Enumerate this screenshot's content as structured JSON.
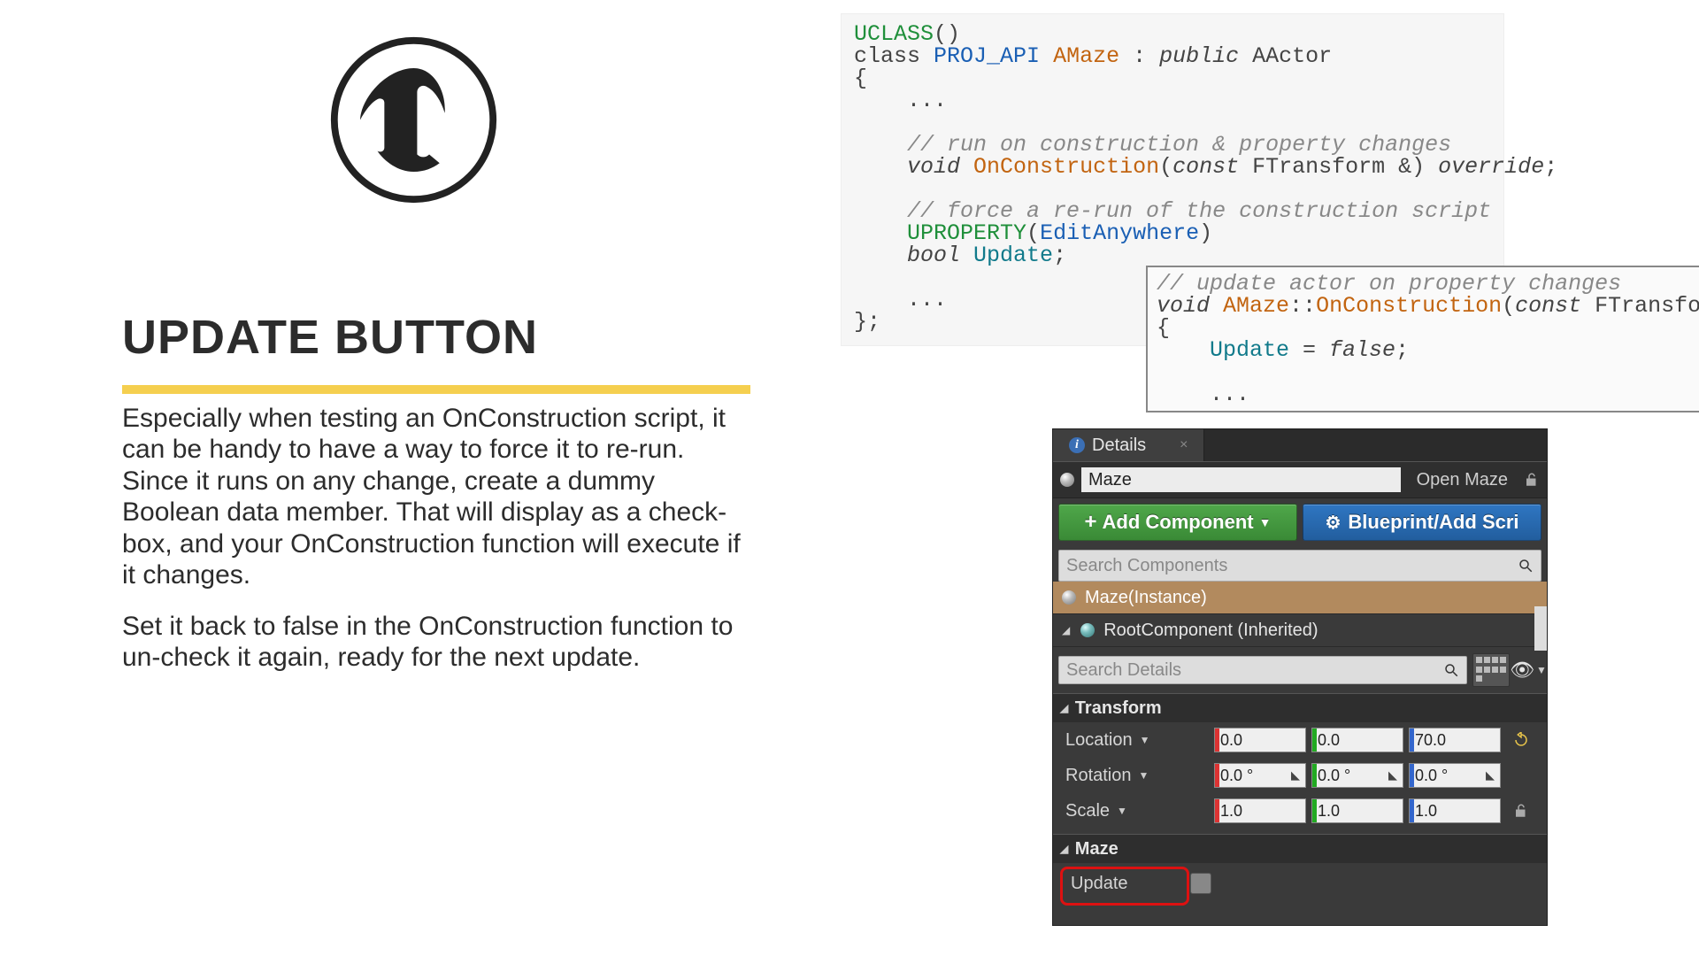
{
  "title": "UPDATE BUTTON",
  "body1": "Especially when testing an OnConstruction script, it can be handy to have a way to force it to re-run. Since it runs on any change, create a dummy Boolean data member. That will display as a check-box, and your OnConstruction function will execute if it changes.",
  "body2": "Set it back to false in the OnConstruction function to un-check it again, ready for the next update.",
  "code1": {
    "l1a": "UCLASS",
    "l1b": "()",
    "l2a": "class ",
    "l2b": "PROJ_API",
    "l2c": " ",
    "l2d": "AMaze",
    "l2e": " : ",
    "l2f": "public",
    "l2g": " AActor",
    "l3": "{",
    "l4": "    ...",
    "l5": "    // run on construction & property changes",
    "l6a": "    ",
    "l6b": "void",
    "l6c": " ",
    "l6d": "OnConstruction",
    "l6e": "(",
    "l6f": "const",
    "l6g": " FTransform &) ",
    "l6h": "override",
    "l6i": ";",
    "l7": "    // force a re-run of the construction script",
    "l8a": "    ",
    "l8b": "UPROPERTY",
    "l8c": "(",
    "l8d": "EditAnywhere",
    "l8e": ")",
    "l9a": "    ",
    "l9b": "bool",
    "l9c": " ",
    "l9d": "Update",
    "l9e": ";",
    "l10": "    ...",
    "l11": "};"
  },
  "code2": {
    "l1": "// update actor on property changes",
    "l2a": "void",
    "l2b": " ",
    "l2c": "AMaze",
    "l2d": "::",
    "l2e": "OnConstruction",
    "l2f": "(",
    "l2g": "const",
    "l2h": " FTransform &)",
    "l3": "{",
    "l4a": "    ",
    "l4b": "Update",
    "l4c": " = ",
    "l4d": "false",
    "l4e": ";",
    "l5": "    ..."
  },
  "details": {
    "tab": "Details",
    "actorName": "Maze",
    "openBtn": "Open Maze",
    "addComponent": "Add Component",
    "blueprintBtn": "Blueprint/Add Scri",
    "searchComponents": "Search Components",
    "instanceRow": "Maze(Instance)",
    "rootRow": "RootComponent (Inherited)",
    "searchDetails": "Search Details",
    "transform": {
      "header": "Transform",
      "location": {
        "label": "Location",
        "x": "0.0",
        "y": "0.0",
        "z": "70.0"
      },
      "rotation": {
        "label": "Rotation",
        "x": "0.0 °",
        "y": "0.0 °",
        "z": "0.0 °"
      },
      "scale": {
        "label": "Scale",
        "x": "1.0",
        "y": "1.0",
        "z": "1.0"
      }
    },
    "maze": {
      "header": "Maze",
      "updateLabel": "Update"
    }
  }
}
